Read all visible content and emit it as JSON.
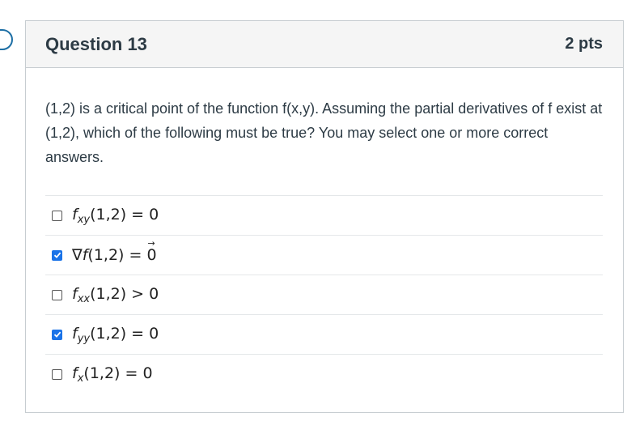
{
  "question": {
    "title": "Question 13",
    "points": "2 pts",
    "text": "(1,2) is a critical point of the function f(x,y).  Assuming the partial derivatives of f exist at (1,2), which of the following must be true?  You may select one or more correct answers."
  },
  "answers": [
    {
      "checked": false,
      "fn": "f",
      "sub": "xy",
      "expr": "(1,2) = 0"
    },
    {
      "checked": true,
      "fn": "∇f",
      "sub": "",
      "expr": "(1,2) = ",
      "rhs": "0",
      "rhs_vector": true
    },
    {
      "checked": false,
      "fn": "f",
      "sub": "xx",
      "expr": "(1,2) > 0"
    },
    {
      "checked": true,
      "fn": "f",
      "sub": "yy",
      "expr": "(1,2) = 0"
    },
    {
      "checked": false,
      "fn": "f",
      "sub": "x",
      "expr": "(1,2) = 0"
    }
  ],
  "colors": {
    "checkbox_checked": "#1a73e8",
    "header_bg": "#f5f5f5",
    "border": "#c7cdd1"
  }
}
